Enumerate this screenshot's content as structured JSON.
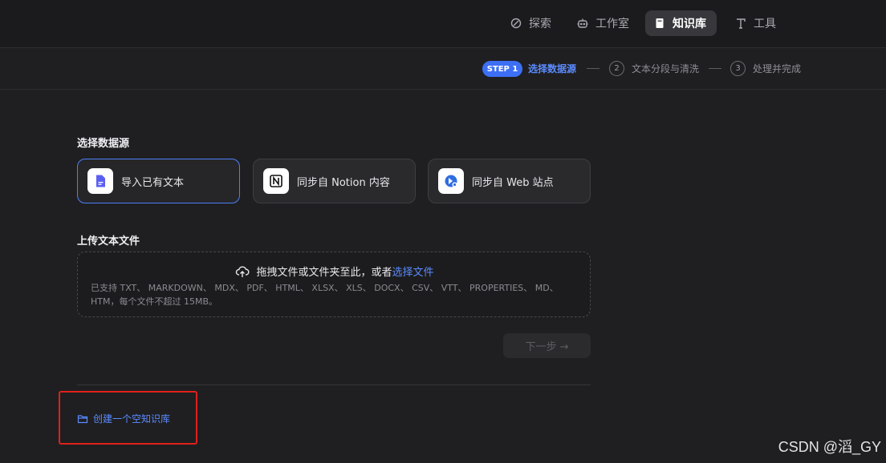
{
  "nav": {
    "items": [
      {
        "label": "探索",
        "icon": "explore-icon",
        "active": false
      },
      {
        "label": "工作室",
        "icon": "robot-icon",
        "active": false
      },
      {
        "label": "知识库",
        "icon": "book-icon",
        "active": true
      },
      {
        "label": "工具",
        "icon": "tools-icon",
        "active": false
      }
    ]
  },
  "stepper": {
    "badge": "STEP 1",
    "step1_label": "选择数据源",
    "step2_num": "2",
    "step2_label": "文本分段与清洗",
    "step3_num": "3",
    "step3_label": "处理并完成"
  },
  "source": {
    "title": "选择数据源",
    "cards": [
      {
        "label": "导入已有文本",
        "icon": "file-text-icon",
        "selected": true
      },
      {
        "label": "同步自 Notion 内容",
        "icon": "notion-icon",
        "selected": false
      },
      {
        "label": "同步自 Web 站点",
        "icon": "web-icon",
        "selected": false
      }
    ]
  },
  "upload": {
    "title": "上传文本文件",
    "drop_text": "拖拽文件或文件夹至此，或者",
    "select_link": "选择文件",
    "formats": "已支持 TXT、 MARKDOWN、 MDX、 PDF、 HTML、 XLSX、 XLS、 DOCX、 CSV、 VTT、 PROPERTIES、 MD、 HTM，每个文件不超过 15MB。"
  },
  "next_button": "下一步 →",
  "create_empty": "创建一个空知识库",
  "watermark": "CSDN @滔_GY",
  "colors": {
    "accent": "#3d6ff5",
    "link": "#5b8bff",
    "highlight": "#e0201c",
    "background": "#1f1f21"
  }
}
